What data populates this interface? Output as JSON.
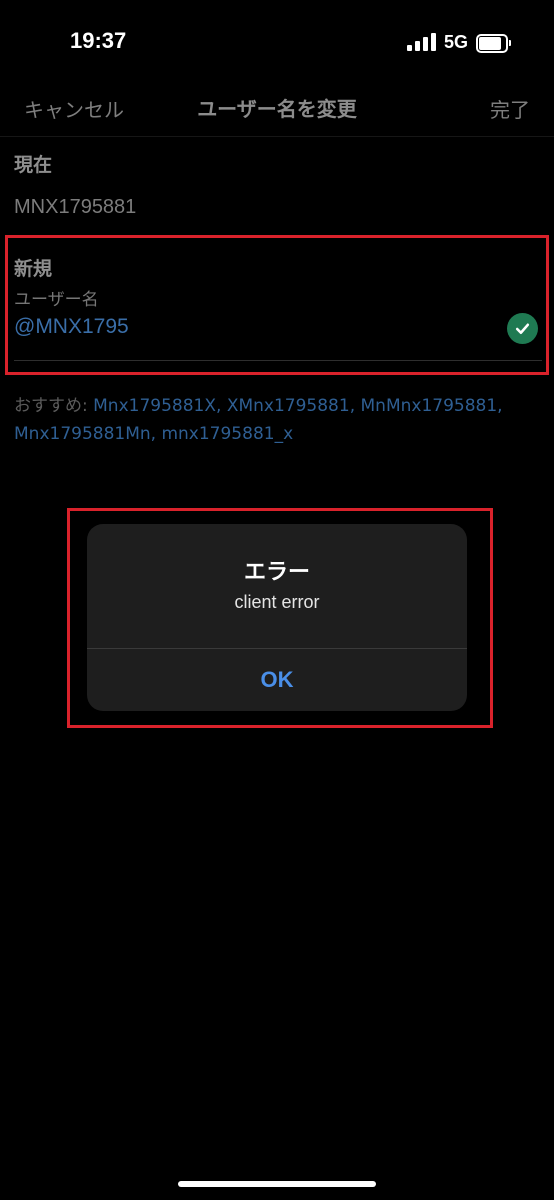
{
  "status_bar": {
    "time": "19:37",
    "network": "5G",
    "battery_level": 0.85
  },
  "nav": {
    "cancel_label": "キャンセル",
    "title": "ユーザー名を変更",
    "done_label": "完了"
  },
  "current": {
    "label": "現在",
    "value": "MNX1795881"
  },
  "new": {
    "label": "新規",
    "field_label": "ユーザー名",
    "input_value": "@MNX1795",
    "valid_icon": "checkmark-circle-icon"
  },
  "suggestions": {
    "prefix": "おすすめ: ",
    "items": [
      "Mnx1795881X",
      "XMnx1795881",
      "MnMnx1795881",
      "Mnx1795881Mn",
      "mnx1795881_x"
    ]
  },
  "alert": {
    "title": "エラー",
    "message": "client error",
    "ok_label": "OK"
  },
  "colors": {
    "accent_link": "#2f5f93",
    "highlight_border": "#d9222b",
    "valid_green": "#1f7a52",
    "alert_button": "#4a8fe8"
  }
}
